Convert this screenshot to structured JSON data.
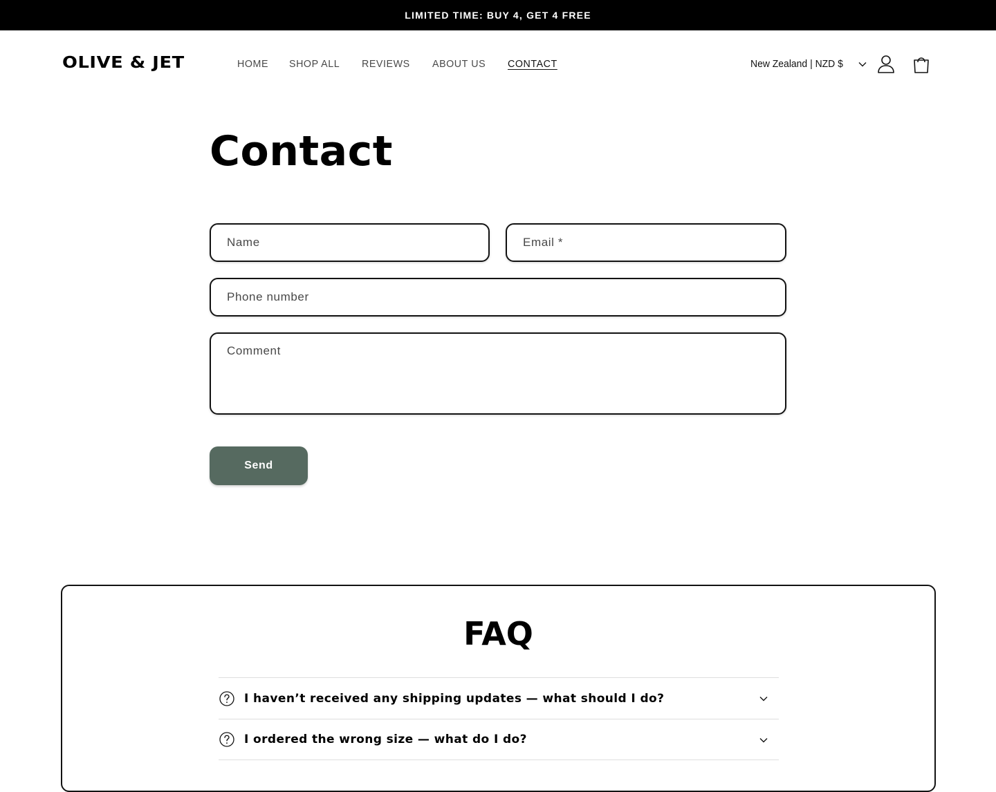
{
  "announcement": {
    "text": "LIMITED TIME: BUY 4, GET 4 FREE"
  },
  "header": {
    "logo": "OLIVE & JET",
    "nav": [
      {
        "label": "HOME",
        "active": false
      },
      {
        "label": "SHOP ALL",
        "active": false
      },
      {
        "label": "REVIEWS",
        "active": false
      },
      {
        "label": "ABOUT US",
        "active": false
      },
      {
        "label": "CONTACT",
        "active": true
      }
    ],
    "locale": "New Zealand | NZD $",
    "icons": {
      "locale_dropdown": "chevron-down-icon",
      "account": "account-icon",
      "cart": "cart-icon"
    }
  },
  "contact": {
    "title": "Contact",
    "fields": {
      "name_placeholder": "Name",
      "email_placeholder": "Email *",
      "phone_placeholder": "Phone number",
      "comment_placeholder": "Comment"
    },
    "send_label": "Send"
  },
  "faq": {
    "title": "FAQ",
    "items": [
      {
        "question": "I haven’t received any shipping updates — what should I do?"
      },
      {
        "question": "I ordered the wrong size — what do I do?"
      }
    ]
  },
  "colors": {
    "accent_button": "#566a60",
    "announcement_bg": "#000000",
    "text": "#121212"
  }
}
